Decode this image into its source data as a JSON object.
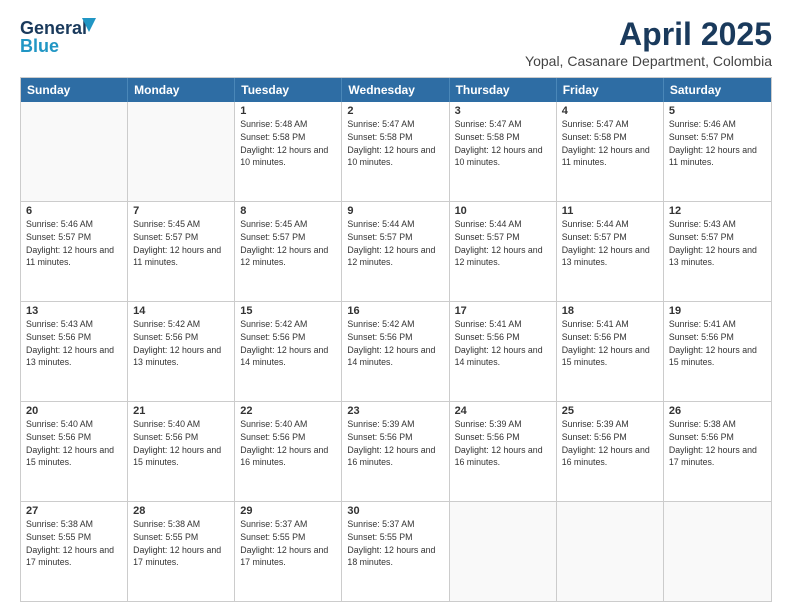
{
  "header": {
    "logo_line1": "General",
    "logo_line2": "Blue",
    "month": "April 2025",
    "location": "Yopal, Casanare Department, Colombia"
  },
  "weekdays": [
    "Sunday",
    "Monday",
    "Tuesday",
    "Wednesday",
    "Thursday",
    "Friday",
    "Saturday"
  ],
  "rows": [
    [
      {
        "day": "",
        "sunrise": "",
        "sunset": "",
        "daylight": ""
      },
      {
        "day": "",
        "sunrise": "",
        "sunset": "",
        "daylight": ""
      },
      {
        "day": "1",
        "sunrise": "Sunrise: 5:48 AM",
        "sunset": "Sunset: 5:58 PM",
        "daylight": "Daylight: 12 hours and 10 minutes."
      },
      {
        "day": "2",
        "sunrise": "Sunrise: 5:47 AM",
        "sunset": "Sunset: 5:58 PM",
        "daylight": "Daylight: 12 hours and 10 minutes."
      },
      {
        "day": "3",
        "sunrise": "Sunrise: 5:47 AM",
        "sunset": "Sunset: 5:58 PM",
        "daylight": "Daylight: 12 hours and 10 minutes."
      },
      {
        "day": "4",
        "sunrise": "Sunrise: 5:47 AM",
        "sunset": "Sunset: 5:58 PM",
        "daylight": "Daylight: 12 hours and 11 minutes."
      },
      {
        "day": "5",
        "sunrise": "Sunrise: 5:46 AM",
        "sunset": "Sunset: 5:57 PM",
        "daylight": "Daylight: 12 hours and 11 minutes."
      }
    ],
    [
      {
        "day": "6",
        "sunrise": "Sunrise: 5:46 AM",
        "sunset": "Sunset: 5:57 PM",
        "daylight": "Daylight: 12 hours and 11 minutes."
      },
      {
        "day": "7",
        "sunrise": "Sunrise: 5:45 AM",
        "sunset": "Sunset: 5:57 PM",
        "daylight": "Daylight: 12 hours and 11 minutes."
      },
      {
        "day": "8",
        "sunrise": "Sunrise: 5:45 AM",
        "sunset": "Sunset: 5:57 PM",
        "daylight": "Daylight: 12 hours and 12 minutes."
      },
      {
        "day": "9",
        "sunrise": "Sunrise: 5:44 AM",
        "sunset": "Sunset: 5:57 PM",
        "daylight": "Daylight: 12 hours and 12 minutes."
      },
      {
        "day": "10",
        "sunrise": "Sunrise: 5:44 AM",
        "sunset": "Sunset: 5:57 PM",
        "daylight": "Daylight: 12 hours and 12 minutes."
      },
      {
        "day": "11",
        "sunrise": "Sunrise: 5:44 AM",
        "sunset": "Sunset: 5:57 PM",
        "daylight": "Daylight: 12 hours and 13 minutes."
      },
      {
        "day": "12",
        "sunrise": "Sunrise: 5:43 AM",
        "sunset": "Sunset: 5:57 PM",
        "daylight": "Daylight: 12 hours and 13 minutes."
      }
    ],
    [
      {
        "day": "13",
        "sunrise": "Sunrise: 5:43 AM",
        "sunset": "Sunset: 5:56 PM",
        "daylight": "Daylight: 12 hours and 13 minutes."
      },
      {
        "day": "14",
        "sunrise": "Sunrise: 5:42 AM",
        "sunset": "Sunset: 5:56 PM",
        "daylight": "Daylight: 12 hours and 13 minutes."
      },
      {
        "day": "15",
        "sunrise": "Sunrise: 5:42 AM",
        "sunset": "Sunset: 5:56 PM",
        "daylight": "Daylight: 12 hours and 14 minutes."
      },
      {
        "day": "16",
        "sunrise": "Sunrise: 5:42 AM",
        "sunset": "Sunset: 5:56 PM",
        "daylight": "Daylight: 12 hours and 14 minutes."
      },
      {
        "day": "17",
        "sunrise": "Sunrise: 5:41 AM",
        "sunset": "Sunset: 5:56 PM",
        "daylight": "Daylight: 12 hours and 14 minutes."
      },
      {
        "day": "18",
        "sunrise": "Sunrise: 5:41 AM",
        "sunset": "Sunset: 5:56 PM",
        "daylight": "Daylight: 12 hours and 15 minutes."
      },
      {
        "day": "19",
        "sunrise": "Sunrise: 5:41 AM",
        "sunset": "Sunset: 5:56 PM",
        "daylight": "Daylight: 12 hours and 15 minutes."
      }
    ],
    [
      {
        "day": "20",
        "sunrise": "Sunrise: 5:40 AM",
        "sunset": "Sunset: 5:56 PM",
        "daylight": "Daylight: 12 hours and 15 minutes."
      },
      {
        "day": "21",
        "sunrise": "Sunrise: 5:40 AM",
        "sunset": "Sunset: 5:56 PM",
        "daylight": "Daylight: 12 hours and 15 minutes."
      },
      {
        "day": "22",
        "sunrise": "Sunrise: 5:40 AM",
        "sunset": "Sunset: 5:56 PM",
        "daylight": "Daylight: 12 hours and 16 minutes."
      },
      {
        "day": "23",
        "sunrise": "Sunrise: 5:39 AM",
        "sunset": "Sunset: 5:56 PM",
        "daylight": "Daylight: 12 hours and 16 minutes."
      },
      {
        "day": "24",
        "sunrise": "Sunrise: 5:39 AM",
        "sunset": "Sunset: 5:56 PM",
        "daylight": "Daylight: 12 hours and 16 minutes."
      },
      {
        "day": "25",
        "sunrise": "Sunrise: 5:39 AM",
        "sunset": "Sunset: 5:56 PM",
        "daylight": "Daylight: 12 hours and 16 minutes."
      },
      {
        "day": "26",
        "sunrise": "Sunrise: 5:38 AM",
        "sunset": "Sunset: 5:56 PM",
        "daylight": "Daylight: 12 hours and 17 minutes."
      }
    ],
    [
      {
        "day": "27",
        "sunrise": "Sunrise: 5:38 AM",
        "sunset": "Sunset: 5:55 PM",
        "daylight": "Daylight: 12 hours and 17 minutes."
      },
      {
        "day": "28",
        "sunrise": "Sunrise: 5:38 AM",
        "sunset": "Sunset: 5:55 PM",
        "daylight": "Daylight: 12 hours and 17 minutes."
      },
      {
        "day": "29",
        "sunrise": "Sunrise: 5:37 AM",
        "sunset": "Sunset: 5:55 PM",
        "daylight": "Daylight: 12 hours and 17 minutes."
      },
      {
        "day": "30",
        "sunrise": "Sunrise: 5:37 AM",
        "sunset": "Sunset: 5:55 PM",
        "daylight": "Daylight: 12 hours and 18 minutes."
      },
      {
        "day": "",
        "sunrise": "",
        "sunset": "",
        "daylight": ""
      },
      {
        "day": "",
        "sunrise": "",
        "sunset": "",
        "daylight": ""
      },
      {
        "day": "",
        "sunrise": "",
        "sunset": "",
        "daylight": ""
      }
    ]
  ]
}
